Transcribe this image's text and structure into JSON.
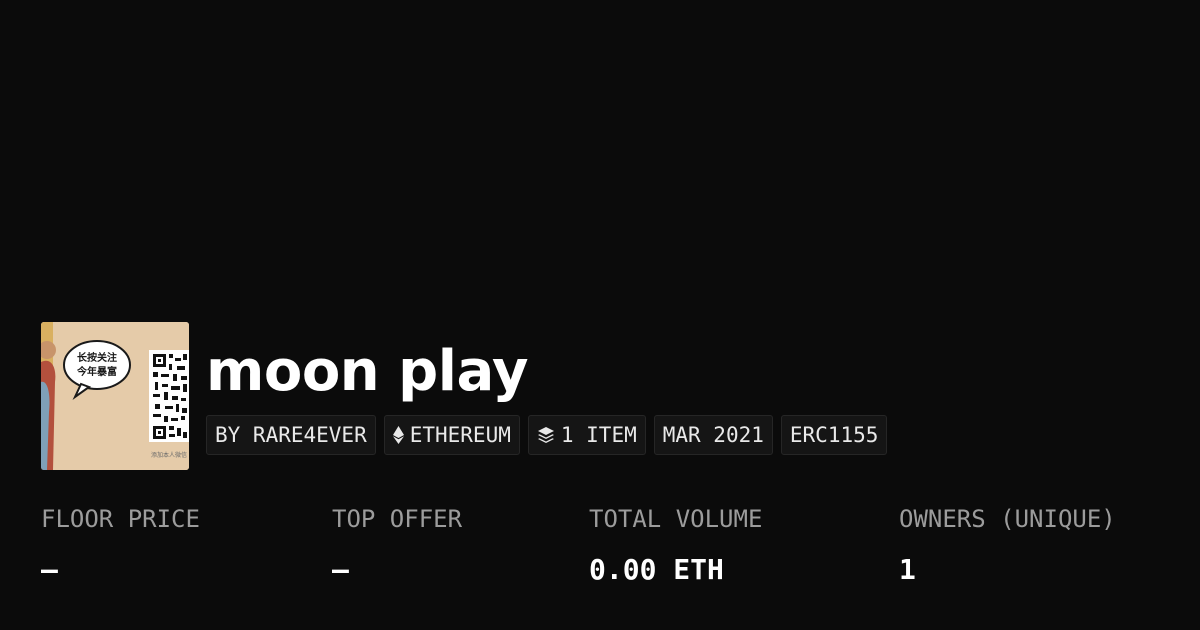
{
  "collection": {
    "title": "moon play",
    "thumbnail_speech": [
      "长按关注",
      "今年暴富"
    ],
    "thumbnail_caption": "添加本人微信"
  },
  "badges": {
    "creator": "BY RARE4EVER",
    "chain": "ETHEREUM",
    "chain_icon": "ethereum-icon",
    "items": "1 ITEM",
    "items_icon": "layers-icon",
    "date": "MAR 2021",
    "standard": "ERC1155"
  },
  "stats": {
    "floor_price": {
      "label": "FLOOR PRICE",
      "value": "–"
    },
    "top_offer": {
      "label": "TOP OFFER",
      "value": "–"
    },
    "total_volume": {
      "label": "TOTAL VOLUME",
      "value": "0.00 ETH"
    },
    "owners": {
      "label": "OWNERS (UNIQUE)",
      "value": "1"
    }
  },
  "colors": {
    "background": "#0b0b0b",
    "badge_bg": "#151515",
    "label": "#9c9c9c",
    "text": "#ffffff"
  }
}
